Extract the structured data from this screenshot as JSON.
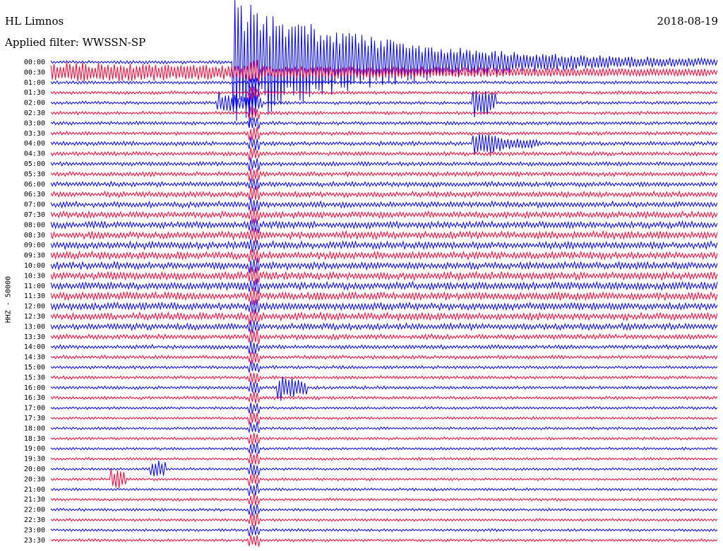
{
  "header": {
    "station": "HL Limnos",
    "filter": "Applied filter: WWSSN-SP",
    "date": "2018-08-19"
  },
  "yaxis_label": "HHZ - 50000",
  "colors": {
    "trace_a": "#0000ff",
    "trace_b": "#ff0033",
    "background": "#ffffff"
  },
  "chart_data": {
    "type": "line",
    "title": "HL Limnos",
    "subtitle": "Applied filter: WWSSN-SP",
    "ylabel": "HHZ - 50000",
    "xlabel": "",
    "rows": [
      "00:00",
      "00:30",
      "01:00",
      "01:30",
      "02:00",
      "02:30",
      "03:00",
      "03:30",
      "04:00",
      "04:30",
      "05:00",
      "05:30",
      "06:00",
      "06:30",
      "07:00",
      "07:30",
      "08:00",
      "08:30",
      "09:00",
      "09:30",
      "10:00",
      "10:30",
      "11:00",
      "11:30",
      "12:00",
      "12:30",
      "13:00",
      "13:30",
      "14:00",
      "14:30",
      "15:00",
      "15:30",
      "16:00",
      "16:30",
      "17:00",
      "17:30",
      "18:00",
      "18:30",
      "19:00",
      "19:30",
      "20:00",
      "20:30",
      "21:00",
      "21:30",
      "22:00",
      "22:30",
      "23:00",
      "23:30"
    ],
    "row_minutes": 30,
    "series_colors": [
      "#0000ff",
      "#ff0033"
    ],
    "noise_level": [
      0.35,
      0.45,
      0.35,
      0.35,
      0.35,
      0.35,
      0.4,
      0.4,
      0.45,
      0.45,
      0.45,
      0.5,
      0.55,
      0.6,
      0.65,
      0.7,
      0.75,
      0.8,
      0.8,
      0.8,
      0.8,
      0.85,
      0.85,
      0.85,
      0.8,
      0.8,
      0.7,
      0.55,
      0.45,
      0.4,
      0.35,
      0.35,
      0.35,
      0.35,
      0.3,
      0.3,
      0.3,
      0.3,
      0.3,
      0.3,
      0.3,
      0.3,
      0.3,
      0.3,
      0.3,
      0.3,
      0.3,
      0.3
    ],
    "events": [
      {
        "row": 0,
        "start_min": 8.2,
        "end_min": 30,
        "amplitude": 9.0,
        "decay": 0.15
      },
      {
        "row": 1,
        "start_min": 0,
        "end_min": 30,
        "amplitude": 1.2,
        "decay": 0.05
      },
      {
        "row": 4,
        "start_min": 7.5,
        "end_min": 9.5,
        "amplitude": 1.5,
        "decay": 0.5
      },
      {
        "row": 4,
        "start_min": 19.0,
        "end_min": 20.0,
        "amplitude": 2.0,
        "decay": 0.5
      },
      {
        "row": 8,
        "start_min": 19.0,
        "end_min": 22.0,
        "amplitude": 1.8,
        "decay": 0.6
      },
      {
        "row": 32,
        "start_min": 10.2,
        "end_min": 11.5,
        "amplitude": 1.8,
        "decay": 0.5
      },
      {
        "row": 40,
        "start_min": 4.5,
        "end_min": 5.2,
        "amplitude": 1.4,
        "decay": 0.5
      },
      {
        "row": 41,
        "start_min": 2.7,
        "end_min": 3.4,
        "amplitude": 1.4,
        "decay": 0.5
      }
    ],
    "persistent_band": {
      "start_min": 8.9,
      "end_min": 9.4,
      "amplitude": 1.3
    }
  }
}
